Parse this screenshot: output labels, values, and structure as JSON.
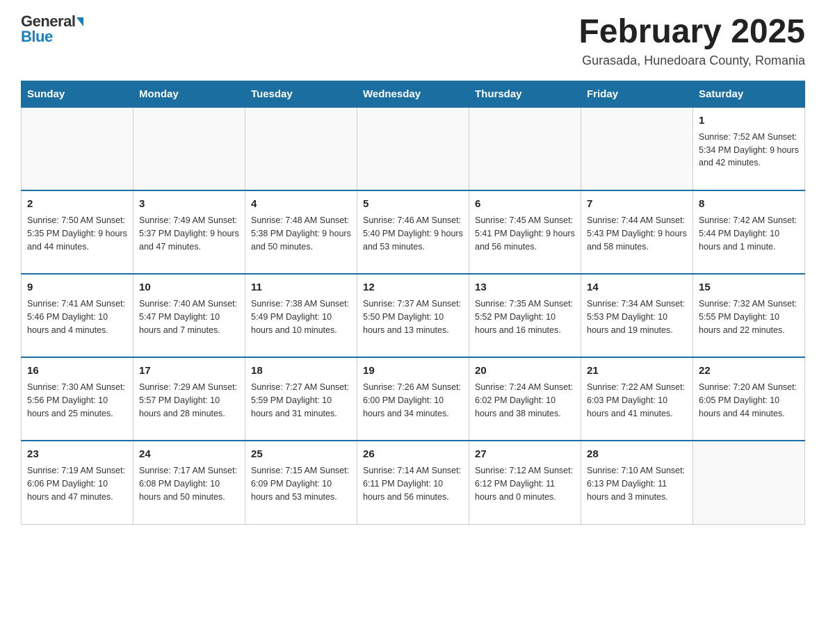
{
  "header": {
    "logo_general": "General",
    "logo_blue": "Blue",
    "title": "February 2025",
    "subtitle": "Gurasada, Hunedoara County, Romania"
  },
  "days_of_week": [
    "Sunday",
    "Monday",
    "Tuesday",
    "Wednesday",
    "Thursday",
    "Friday",
    "Saturday"
  ],
  "weeks": [
    [
      {
        "day": "",
        "info": ""
      },
      {
        "day": "",
        "info": ""
      },
      {
        "day": "",
        "info": ""
      },
      {
        "day": "",
        "info": ""
      },
      {
        "day": "",
        "info": ""
      },
      {
        "day": "",
        "info": ""
      },
      {
        "day": "1",
        "info": "Sunrise: 7:52 AM\nSunset: 5:34 PM\nDaylight: 9 hours and 42 minutes."
      }
    ],
    [
      {
        "day": "2",
        "info": "Sunrise: 7:50 AM\nSunset: 5:35 PM\nDaylight: 9 hours and 44 minutes."
      },
      {
        "day": "3",
        "info": "Sunrise: 7:49 AM\nSunset: 5:37 PM\nDaylight: 9 hours and 47 minutes."
      },
      {
        "day": "4",
        "info": "Sunrise: 7:48 AM\nSunset: 5:38 PM\nDaylight: 9 hours and 50 minutes."
      },
      {
        "day": "5",
        "info": "Sunrise: 7:46 AM\nSunset: 5:40 PM\nDaylight: 9 hours and 53 minutes."
      },
      {
        "day": "6",
        "info": "Sunrise: 7:45 AM\nSunset: 5:41 PM\nDaylight: 9 hours and 56 minutes."
      },
      {
        "day": "7",
        "info": "Sunrise: 7:44 AM\nSunset: 5:43 PM\nDaylight: 9 hours and 58 minutes."
      },
      {
        "day": "8",
        "info": "Sunrise: 7:42 AM\nSunset: 5:44 PM\nDaylight: 10 hours and 1 minute."
      }
    ],
    [
      {
        "day": "9",
        "info": "Sunrise: 7:41 AM\nSunset: 5:46 PM\nDaylight: 10 hours and 4 minutes."
      },
      {
        "day": "10",
        "info": "Sunrise: 7:40 AM\nSunset: 5:47 PM\nDaylight: 10 hours and 7 minutes."
      },
      {
        "day": "11",
        "info": "Sunrise: 7:38 AM\nSunset: 5:49 PM\nDaylight: 10 hours and 10 minutes."
      },
      {
        "day": "12",
        "info": "Sunrise: 7:37 AM\nSunset: 5:50 PM\nDaylight: 10 hours and 13 minutes."
      },
      {
        "day": "13",
        "info": "Sunrise: 7:35 AM\nSunset: 5:52 PM\nDaylight: 10 hours and 16 minutes."
      },
      {
        "day": "14",
        "info": "Sunrise: 7:34 AM\nSunset: 5:53 PM\nDaylight: 10 hours and 19 minutes."
      },
      {
        "day": "15",
        "info": "Sunrise: 7:32 AM\nSunset: 5:55 PM\nDaylight: 10 hours and 22 minutes."
      }
    ],
    [
      {
        "day": "16",
        "info": "Sunrise: 7:30 AM\nSunset: 5:56 PM\nDaylight: 10 hours and 25 minutes."
      },
      {
        "day": "17",
        "info": "Sunrise: 7:29 AM\nSunset: 5:57 PM\nDaylight: 10 hours and 28 minutes."
      },
      {
        "day": "18",
        "info": "Sunrise: 7:27 AM\nSunset: 5:59 PM\nDaylight: 10 hours and 31 minutes."
      },
      {
        "day": "19",
        "info": "Sunrise: 7:26 AM\nSunset: 6:00 PM\nDaylight: 10 hours and 34 minutes."
      },
      {
        "day": "20",
        "info": "Sunrise: 7:24 AM\nSunset: 6:02 PM\nDaylight: 10 hours and 38 minutes."
      },
      {
        "day": "21",
        "info": "Sunrise: 7:22 AM\nSunset: 6:03 PM\nDaylight: 10 hours and 41 minutes."
      },
      {
        "day": "22",
        "info": "Sunrise: 7:20 AM\nSunset: 6:05 PM\nDaylight: 10 hours and 44 minutes."
      }
    ],
    [
      {
        "day": "23",
        "info": "Sunrise: 7:19 AM\nSunset: 6:06 PM\nDaylight: 10 hours and 47 minutes."
      },
      {
        "day": "24",
        "info": "Sunrise: 7:17 AM\nSunset: 6:08 PM\nDaylight: 10 hours and 50 minutes."
      },
      {
        "day": "25",
        "info": "Sunrise: 7:15 AM\nSunset: 6:09 PM\nDaylight: 10 hours and 53 minutes."
      },
      {
        "day": "26",
        "info": "Sunrise: 7:14 AM\nSunset: 6:11 PM\nDaylight: 10 hours and 56 minutes."
      },
      {
        "day": "27",
        "info": "Sunrise: 7:12 AM\nSunset: 6:12 PM\nDaylight: 11 hours and 0 minutes."
      },
      {
        "day": "28",
        "info": "Sunrise: 7:10 AM\nSunset: 6:13 PM\nDaylight: 11 hours and 3 minutes."
      },
      {
        "day": "",
        "info": ""
      }
    ]
  ]
}
